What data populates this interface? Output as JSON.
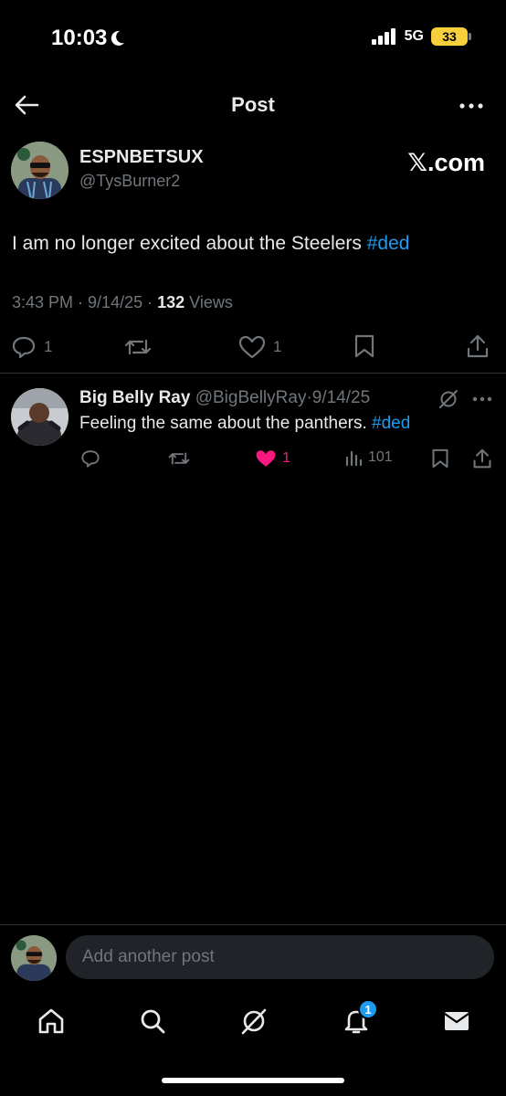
{
  "status_bar": {
    "time": "10:03",
    "network": "5G",
    "battery": "33"
  },
  "header": {
    "title": "Post"
  },
  "post": {
    "author_name": "ESPNBETSUX",
    "author_handle": "@TysBurner2",
    "source_label": "𝕏.com",
    "text": "I am no longer excited about the Steelers ",
    "hashtag": "#ded",
    "time": "3:43 PM",
    "date": "9/14/25",
    "views_count": "132",
    "views_label": "Views",
    "reply_count": "1",
    "like_count": "1"
  },
  "reply": {
    "author_name": "Big Belly Ray",
    "author_handle": "@BigBellyRay",
    "date": "9/14/25",
    "text": "Feeling the same about the panthers. ",
    "hashtag": "#ded",
    "like_count": "1",
    "view_count": "101"
  },
  "composer": {
    "placeholder": "Add another post"
  },
  "tabbar": {
    "notification_badge": "1"
  },
  "colors": {
    "accent": "#1d9bf0",
    "like": "#f91880",
    "muted": "#71767b",
    "battery": "#f7cf3a"
  }
}
